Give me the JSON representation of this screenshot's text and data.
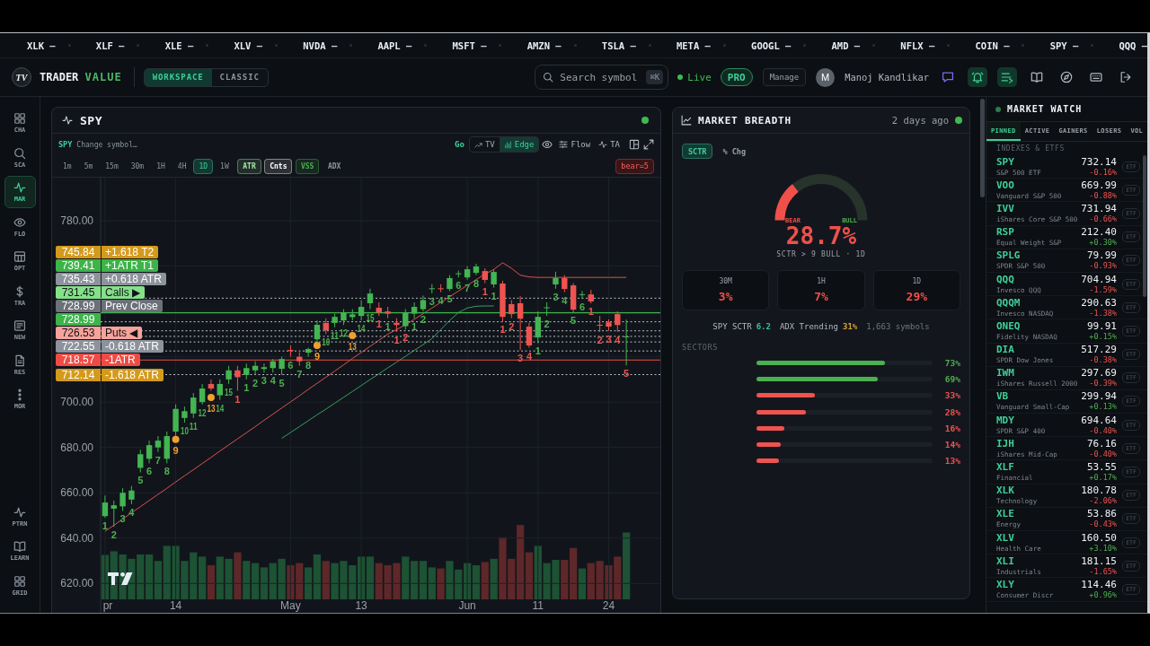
{
  "ticker": [
    {
      "symbol": "XLK",
      "change": "—"
    },
    {
      "symbol": "XLF",
      "change": "—"
    },
    {
      "symbol": "XLE",
      "change": "—"
    },
    {
      "symbol": "XLV",
      "change": "—"
    },
    {
      "symbol": "NVDA",
      "change": "—"
    },
    {
      "symbol": "AAPL",
      "change": "—"
    },
    {
      "symbol": "MSFT",
      "change": "—"
    },
    {
      "symbol": "AMZN",
      "change": "—"
    },
    {
      "symbol": "TSLA",
      "change": "—"
    },
    {
      "symbol": "META",
      "change": "—"
    },
    {
      "symbol": "GOOGL",
      "change": "—"
    },
    {
      "symbol": "AMD",
      "change": "—"
    },
    {
      "symbol": "NFLX",
      "change": "—"
    },
    {
      "symbol": "COIN",
      "change": "—"
    },
    {
      "symbol": "SPY",
      "change": "—"
    },
    {
      "symbol": "QQQ",
      "change": "—"
    }
  ],
  "header": {
    "logo": "TV",
    "brand": "TRADER",
    "brand_accent": "VALUE",
    "modes": [
      {
        "label": "WORKSPACE",
        "selected": true
      },
      {
        "label": "CLASSIC",
        "selected": false
      }
    ],
    "search": {
      "placeholder": "Search symbol",
      "shortcut": "⌘K"
    },
    "status": {
      "label": "Live",
      "online": true
    },
    "plan": "PRO",
    "manage": "Manage",
    "user": {
      "initial": "M",
      "name": "Manoj Kandlikar"
    },
    "actions": [
      {
        "active": false
      },
      {
        "active": true
      },
      {
        "active": true
      },
      {
        "active": false
      },
      {
        "active": false
      },
      {
        "active": false
      },
      {
        "active": false
      }
    ]
  },
  "sidebar": {
    "items": [
      {
        "label": "CHA",
        "selected": false
      },
      {
        "label": "SCA",
        "selected": false
      },
      {
        "label": "MAR",
        "selected": true
      },
      {
        "label": "FLO",
        "selected": false
      },
      {
        "label": "OPT",
        "selected": false
      },
      {
        "label": "TRA",
        "selected": false
      },
      {
        "label": "NEW",
        "selected": false
      },
      {
        "label": "RES",
        "selected": false
      },
      {
        "label": "MOR",
        "selected": false
      }
    ],
    "bottom_items": [
      {
        "label": "PTRN",
        "selected": false
      },
      {
        "label": "LEARN",
        "selected": false
      },
      {
        "label": "GRID",
        "selected": false
      }
    ]
  },
  "chart": {
    "title": "SPY",
    "online": true,
    "symbol": "SPY",
    "symbol_placeholder": "Change symbol…",
    "go": "Go",
    "views": [
      {
        "label": "TV",
        "selected": false
      },
      {
        "label": "Edge",
        "selected": true
      }
    ],
    "tools": [
      "Flow",
      "TA"
    ],
    "timeframes": [
      {
        "label": "1m",
        "selected": false
      },
      {
        "label": "5m",
        "selected": false
      },
      {
        "label": "15m",
        "selected": false
      },
      {
        "label": "30m",
        "selected": false
      },
      {
        "label": "1H",
        "selected": false
      },
      {
        "label": "4H",
        "selected": false
      },
      {
        "label": "1D",
        "selected": true
      },
      {
        "label": "1W",
        "selected": false
      }
    ],
    "indicators": [
      {
        "label": "ATR",
        "on": true,
        "color": "#a5e3a5"
      },
      {
        "label": "Cnts",
        "on": true,
        "color": "#ffffff"
      },
      {
        "label": "VSS",
        "on": true,
        "color": "#4caf50"
      },
      {
        "label": "ADX",
        "on": false
      }
    ],
    "signal": "bear=5",
    "chart_data": [
      {
        "type": "candlestick",
        "grid": true,
        "ylim": [
          613,
          799
        ],
        "yticks": [
          {
            "value": 620,
            "label": "620.00"
          },
          {
            "value": 640,
            "label": "640.00"
          },
          {
            "value": 660,
            "label": "660.00"
          },
          {
            "value": 680,
            "label": "680.00"
          },
          {
            "value": 700,
            "label": "700.00"
          },
          {
            "value": 780,
            "label": "780.00"
          }
        ],
        "categories": [
          "pr",
          null,
          null,
          null,
          null,
          null,
          null,
          null,
          "14",
          null,
          null,
          null,
          null,
          null,
          null,
          null,
          null,
          null,
          null,
          null,
          null,
          "May",
          null,
          null,
          null,
          null,
          null,
          null,
          null,
          "13",
          null,
          null,
          null,
          null,
          null,
          null,
          null,
          null,
          null,
          null,
          null,
          "Jun",
          null,
          null,
          null,
          null,
          null,
          null,
          null,
          "11",
          null,
          null,
          null,
          null,
          null,
          null,
          null,
          "24",
          null,
          null
        ],
        "ohlc": [
          [
            649.7,
            658.8,
            649,
            655.7
          ],
          [
            653,
            656.5,
            645,
            654.5
          ],
          [
            654,
            662,
            652,
            660
          ],
          [
            657,
            663,
            655,
            661
          ],
          [
            671,
            679,
            669,
            677
          ],
          [
            675,
            683,
            673,
            681
          ],
          [
            680,
            685,
            678,
            683
          ],
          [
            675,
            687,
            673,
            685
          ],
          [
            687,
            699,
            685,
            697
          ],
          [
            693,
            698,
            691,
            696
          ],
          [
            695,
            704,
            693,
            702
          ],
          [
            700,
            708,
            699,
            706
          ],
          [
            708,
            710,
            705,
            706
          ],
          [
            703,
            710,
            701,
            708
          ],
          [
            710,
            716,
            708,
            714
          ],
          [
            714,
            716,
            705,
            711
          ],
          [
            712,
            717,
            710,
            715
          ],
          [
            714,
            718,
            712,
            716
          ],
          [
            714.6,
            717,
            713,
            715.4
          ],
          [
            715,
            719,
            713,
            718
          ],
          [
            714.7,
            720,
            712,
            719
          ],
          [
            723,
            725,
            720,
            722.5
          ],
          [
            720,
            722,
            716,
            718
          ],
          [
            721.8,
            724,
            720,
            723.4
          ],
          [
            727.7,
            736,
            726,
            734.1
          ],
          [
            734.9,
            737,
            730,
            731.7
          ],
          [
            734.9,
            739,
            733,
            737.6
          ],
          [
            736,
            741,
            734,
            739.6
          ],
          [
            737.5,
            741,
            736,
            738.7
          ],
          [
            738,
            745,
            736,
            742
          ],
          [
            743.6,
            750,
            741,
            747.9
          ],
          [
            741.6,
            744,
            738,
            739.6
          ],
          [
            740,
            742,
            737,
            739
          ],
          [
            735,
            737,
            731,
            734
          ],
          [
            733.5,
            741,
            732,
            739.6
          ],
          [
            739,
            744,
            737,
            742
          ],
          [
            741,
            747,
            740,
            745
          ],
          [
            749.8,
            752,
            748,
            750.2
          ],
          [
            750.2,
            752,
            748.5,
            749.8
          ],
          [
            749.9,
            756,
            749,
            754.7
          ],
          [
            756.4,
            758,
            755,
            756.8
          ],
          [
            755,
            760,
            754,
            758.6
          ],
          [
            757,
            761,
            756,
            759.8
          ],
          [
            757.8,
            759,
            752.5,
            753.9
          ],
          [
            751.9,
            758.5,
            750.5,
            757.4
          ],
          [
            752.3,
            753.5,
            735.5,
            737.6
          ],
          [
            743.2,
            745,
            737,
            738.8
          ],
          [
            743.6,
            746.7,
            723,
            736.8
          ],
          [
            733.3,
            735,
            724,
            725
          ],
          [
            728.5,
            740,
            726,
            737.6
          ],
          [
            741.4,
            744,
            738,
            741.8
          ],
          [
            751.9,
            757.5,
            750,
            754.7
          ],
          [
            754.7,
            756,
            748.5,
            749.9
          ],
          [
            751.5,
            752.5,
            739.5,
            740.8
          ],
          [
            747.4,
            749,
            745.5,
            747.6
          ],
          [
            747.5,
            749.5,
            743.5,
            744.4
          ],
          [
            734.1,
            738,
            731,
            733.9
          ],
          [
            735.2,
            736.5,
            731.5,
            733.3
          ],
          [
            738.8,
            740,
            731,
            734
          ],
          [
            728.9,
            736.4,
            716.2,
            728.99
          ]
        ],
        "series": [
          {
            "type": "line",
            "color": "#d9534f",
            "values": [
              643,
              645.7,
              648.4,
              651.2,
              653.9,
              656.6,
              659.3,
              662,
              664.8,
              667.5,
              670.2,
              672.9,
              675.6,
              678.4,
              681.1,
              683.8,
              686.5,
              689.2,
              692,
              694.7,
              697.4,
              700.1,
              702.8,
              705.6,
              708.3,
              711,
              713.7,
              716.4,
              719.2,
              721.9,
              724.6,
              727.3,
              730,
              732,
              734,
              736.5,
              739,
              741.5,
              744,
              746.5,
              749,
              751.5,
              754,
              756.5,
              758.5,
              761.5,
              759,
              756,
              755.2,
              755,
              755,
              755,
              755,
              755,
              755,
              755,
              755,
              755,
              755,
              755
            ]
          },
          {
            "type": "line",
            "color": "#3a9d5d",
            "values": [
              null,
              null,
              null,
              null,
              null,
              null,
              null,
              null,
              null,
              null,
              null,
              null,
              null,
              null,
              null,
              null,
              null,
              null,
              null,
              null,
              684,
              686.6,
              689.2,
              691.8,
              694.4,
              696.9,
              699.5,
              702.1,
              704.7,
              707.3,
              709.9,
              712.5,
              715.1,
              717.6,
              720.2,
              722.8,
              725.4,
              728,
              732,
              736,
              739.5,
              741.5,
              742.3,
              742.4,
              742.4,
              null,
              null,
              null,
              null,
              null,
              null,
              null,
              null,
              null,
              null,
              null,
              null,
              null,
              null,
              null
            ]
          },
          {
            "type": "scatter",
            "color": "#f0a030",
            "values": [
              null,
              null,
              null,
              null,
              null,
              null,
              null,
              null,
              683.5,
              null,
              null,
              null,
              702,
              null,
              null,
              null,
              null,
              null,
              null,
              null,
              null,
              null,
              null,
              null,
              725,
              null,
              null,
              null,
              729.3,
              null,
              null,
              null,
              null,
              null,
              null,
              null,
              null,
              null,
              null,
              null,
              null,
              null,
              null,
              null,
              null,
              null,
              null,
              null,
              null,
              null,
              null,
              null,
              null,
              null,
              null,
              null,
              null,
              null,
              null,
              null
            ]
          }
        ],
        "ref_lines": [
          {
            "axis": "y",
            "value": 745.84,
            "color": "#b8bec6",
            "line_style": "dotted"
          },
          {
            "axis": "y",
            "value": 739.41,
            "color": "#3db34a",
            "line_style": "solid"
          },
          {
            "axis": "y",
            "value": 735.43,
            "color": "#b8bec6",
            "line_style": "dotted"
          },
          {
            "axis": "y",
            "value": 731.45,
            "color": "#b8bec6",
            "line_style": "dotted"
          },
          {
            "axis": "y",
            "value": 728.99,
            "color": "#b8bec6",
            "line_style": "dotted"
          },
          {
            "axis": "y",
            "value": 726.53,
            "color": "#b8bec6",
            "line_style": "dotted"
          },
          {
            "axis": "y",
            "value": 722.55,
            "color": "#b8bec6",
            "line_style": "dotted"
          },
          {
            "axis": "y",
            "value": 718.57,
            "color": "#ef4b45",
            "line_style": "solid"
          },
          {
            "axis": "y",
            "value": 712.14,
            "color": "#b8bec6",
            "line_style": "dotted"
          }
        ]
      }
    ],
    "level_tags": [
      {
        "price": "745.84",
        "label": "+1.618 T2",
        "color": "#d49a1c"
      },
      {
        "price": "739.41",
        "label": "+1ATR T1",
        "color": "#3db34a"
      },
      {
        "price": "735.43",
        "label": "+0.618 ATR",
        "color": "#8d939c"
      },
      {
        "price": "731.45",
        "label": "Calls ▶",
        "color": "#86e08a"
      },
      {
        "price": "728.99",
        "label": "Prev Close",
        "color": "#6b7079"
      },
      {
        "price": "726.53",
        "label": "Puts ◀",
        "color": "#f5a39b"
      },
      {
        "price": "722.55",
        "label": "-0.618 ATR",
        "color": "#8d939c"
      },
      {
        "price": "718.57",
        "label": "-1ATR",
        "color": "#ef4b45"
      },
      {
        "price": "712.14",
        "label": "-1.618 ATR",
        "color": "#d49a1c"
      }
    ],
    "last_price": {
      "price": "728.99",
      "color": "#3db34a"
    },
    "count_labels": [
      {
        "text": "1",
        "color": "#4caf50"
      },
      {
        "text": "2",
        "color": "#4caf50"
      },
      {
        "text": "3",
        "color": "#4caf50"
      },
      {
        "text": "4",
        "color": "#4caf50"
      },
      {
        "text": "5",
        "color": "#4caf50"
      },
      {
        "text": "6",
        "color": "#4caf50"
      },
      {
        "text": "7",
        "color": "#4caf50"
      },
      {
        "text": "8",
        "color": "#4caf50"
      },
      {
        "text": "9",
        "color": "#f0a030"
      },
      {
        "text": "10",
        "color": "#4caf50"
      },
      {
        "text": "11",
        "color": "#4caf50"
      },
      {
        "text": "12",
        "color": "#4caf50"
      },
      {
        "text": "13",
        "color": "#f0a030"
      },
      {
        "text": "14",
        "color": "#4caf50"
      },
      {
        "text": "15",
        "color": "#4caf50"
      },
      {
        "text": "1",
        "color": "#ef5350"
      },
      {
        "text": "1",
        "color": "#4caf50"
      },
      {
        "text": "2",
        "color": "#4caf50"
      },
      {
        "text": "3",
        "color": "#4caf50"
      },
      {
        "text": "4",
        "color": "#4caf50"
      },
      {
        "text": "5",
        "color": "#4caf50"
      },
      {
        "text": "6",
        "color": "#4caf50"
      },
      {
        "text": "7",
        "color": "#4caf50"
      },
      {
        "text": "8",
        "color": "#4caf50"
      },
      {
        "text": "9",
        "color": "#f0a030"
      },
      {
        "text": "10",
        "color": "#4caf50"
      },
      {
        "text": "11",
        "color": "#4caf50"
      },
      {
        "text": "12",
        "color": "#4caf50"
      },
      {
        "text": "13",
        "color": "#f0a030"
      },
      {
        "text": "14",
        "color": "#4caf50"
      },
      {
        "text": "15",
        "color": "#4caf50"
      },
      {
        "text": "1",
        "color": "#ef5350"
      },
      {
        "text": "1",
        "color": "#4caf50"
      },
      {
        "text": "1",
        "color": "#ef5350"
      },
      {
        "text": "2",
        "color": "#ef5350"
      },
      {
        "text": "1",
        "color": "#4caf50"
      },
      {
        "text": "2",
        "color": "#4caf50"
      },
      {
        "text": "3",
        "color": "#4caf50"
      },
      {
        "text": "4",
        "color": "#4caf50"
      },
      {
        "text": "5",
        "color": "#4caf50"
      },
      {
        "text": "6",
        "color": "#4caf50"
      },
      {
        "text": "7",
        "color": "#4caf50"
      },
      {
        "text": "8",
        "color": "#4caf50"
      },
      {
        "text": "1",
        "color": "#ef5350"
      },
      {
        "text": "1",
        "color": "#4caf50"
      },
      {
        "text": "1",
        "color": "#ef5350"
      },
      {
        "text": "2",
        "color": "#ef5350"
      },
      {
        "text": "3",
        "color": "#ef5350"
      },
      {
        "text": "4",
        "color": "#ef5350"
      },
      {
        "text": "1",
        "color": "#4caf50"
      },
      {
        "text": "2",
        "color": "#4caf50"
      },
      {
        "text": "3",
        "color": "#4caf50"
      },
      {
        "text": "4",
        "color": "#4caf50"
      },
      {
        "text": "5",
        "color": "#4caf50"
      },
      {
        "text": "6",
        "color": "#4caf50"
      },
      {
        "text": "1",
        "color": "#ef5350"
      },
      {
        "text": "2",
        "color": "#ef5350"
      },
      {
        "text": "3",
        "color": "#ef5350"
      },
      {
        "text": "4",
        "color": "#ef5350"
      },
      {
        "text": "5",
        "color": "#ef5350"
      }
    ]
  },
  "breadth": {
    "title": "MARKET BREADTH",
    "updated": "2 days ago",
    "online": true,
    "modes": [
      {
        "label": "SCTR",
        "selected": true
      },
      {
        "label": "% Chg",
        "selected": false
      }
    ],
    "gauge": {
      "chart_data": [
        {
          "type": "donut",
          "categories": [
            "BEAR",
            "BULL"
          ],
          "values": [
            28.7,
            71.3
          ],
          "colors": [
            "#f0504a",
            "#28332b"
          ]
        }
      ],
      "value": "28.7%",
      "caption": "SCTR > 9 BULL · 1D"
    },
    "periods": [
      {
        "label": "30M",
        "value": "3%"
      },
      {
        "label": "1H",
        "value": "7%"
      },
      {
        "label": "1D",
        "value": "29%"
      }
    ],
    "stats": [
      {
        "label": "SPY SCTR",
        "value": "6.2",
        "color": "#2ec4a4"
      },
      {
        "label": "ADX Trending",
        "value": "31%",
        "color": "#d9a53a"
      }
    ],
    "symbols": "1,663 symbols",
    "sectors_title": "SECTORS",
    "sectors": [
      {
        "level": 0.73,
        "value": "73%",
        "color": "#4caf50"
      },
      {
        "level": 0.69,
        "value": "69%",
        "color": "#4caf50"
      },
      {
        "level": 0.33,
        "value": "33%",
        "color": "#ef5350"
      },
      {
        "level": 0.28,
        "value": "28%",
        "color": "#ef5350"
      },
      {
        "level": 0.16,
        "value": "16%",
        "color": "#ef5350"
      },
      {
        "level": 0.14,
        "value": "14%",
        "color": "#ef5350"
      },
      {
        "level": 0.13,
        "value": "13%",
        "color": "#ef5350"
      }
    ]
  },
  "watch": {
    "title": "MARKET WATCH",
    "online": true,
    "tabs": [
      {
        "label": "PINNED",
        "selected": true
      },
      {
        "label": "ACTIVE",
        "selected": false
      },
      {
        "label": "GAINERS",
        "selected": false
      },
      {
        "label": "LOSERS",
        "selected": false
      },
      {
        "label": "VOL",
        "selected": false
      }
    ],
    "section": "INDEXES & ETFS",
    "rows": [
      {
        "symbol": "SPY",
        "name": "S&P 500 ETF",
        "price": "732.14",
        "change": "-0.16%",
        "up": false,
        "tag": "ETF"
      },
      {
        "symbol": "VOO",
        "name": "Vanguard S&P 500",
        "price": "669.99",
        "change": "-0.88%",
        "up": false,
        "tag": "ETF"
      },
      {
        "symbol": "IVV",
        "name": "iShares Core S&P 500",
        "price": "731.94",
        "change": "-0.66%",
        "up": false,
        "tag": "ETF"
      },
      {
        "symbol": "RSP",
        "name": "Equal Weight S&P",
        "price": "212.40",
        "change": "+0.30%",
        "up": true,
        "tag": "ETF"
      },
      {
        "symbol": "SPLG",
        "name": "SPDR S&P 500",
        "price": "79.99",
        "change": "-0.93%",
        "up": false,
        "tag": "ETF"
      },
      {
        "symbol": "QQQ",
        "name": "Invesco QQQ",
        "price": "704.94",
        "change": "-1.59%",
        "up": false,
        "tag": "ETF"
      },
      {
        "symbol": "QQQM",
        "name": "Invesco NASDAQ",
        "price": "290.63",
        "change": "-1.38%",
        "up": false,
        "tag": "ETF"
      },
      {
        "symbol": "ONEQ",
        "name": "Fidelity NASDAQ",
        "price": "99.91",
        "change": "+0.15%",
        "up": true,
        "tag": "ETF"
      },
      {
        "symbol": "DIA",
        "name": "SPDR Dow Jones",
        "price": "517.29",
        "change": "-0.38%",
        "up": false,
        "tag": "ETF"
      },
      {
        "symbol": "IWM",
        "name": "iShares Russell 2000",
        "price": "297.69",
        "change": "-0.39%",
        "up": false,
        "tag": "ETF"
      },
      {
        "symbol": "VB",
        "name": "Vanguard Small-Cap",
        "price": "299.94",
        "change": "+0.13%",
        "up": true,
        "tag": "ETF"
      },
      {
        "symbol": "MDY",
        "name": "SPDR S&P 400",
        "price": "694.64",
        "change": "-0.40%",
        "up": false,
        "tag": "ETF"
      },
      {
        "symbol": "IJH",
        "name": "iShares Mid-Cap",
        "price": "76.16",
        "change": "-0.40%",
        "up": false,
        "tag": "ETF"
      },
      {
        "symbol": "XLF",
        "name": "Financial",
        "price": "53.55",
        "change": "+0.17%",
        "up": true,
        "tag": "ETF"
      },
      {
        "symbol": "XLK",
        "name": "Technology",
        "price": "180.78",
        "change": "-2.06%",
        "up": false,
        "tag": "ETF"
      },
      {
        "symbol": "XLE",
        "name": "Energy",
        "price": "53.86",
        "change": "-0.43%",
        "up": false,
        "tag": "ETF"
      },
      {
        "symbol": "XLV",
        "name": "Health Care",
        "price": "160.50",
        "change": "+3.10%",
        "up": true,
        "tag": "ETF"
      },
      {
        "symbol": "XLI",
        "name": "Industrials",
        "price": "181.15",
        "change": "-1.65%",
        "up": false,
        "tag": "ETF"
      },
      {
        "symbol": "XLY",
        "name": "Consumer Discr",
        "price": "114.46",
        "change": "+0.96%",
        "up": true,
        "tag": "ETF"
      }
    ]
  }
}
